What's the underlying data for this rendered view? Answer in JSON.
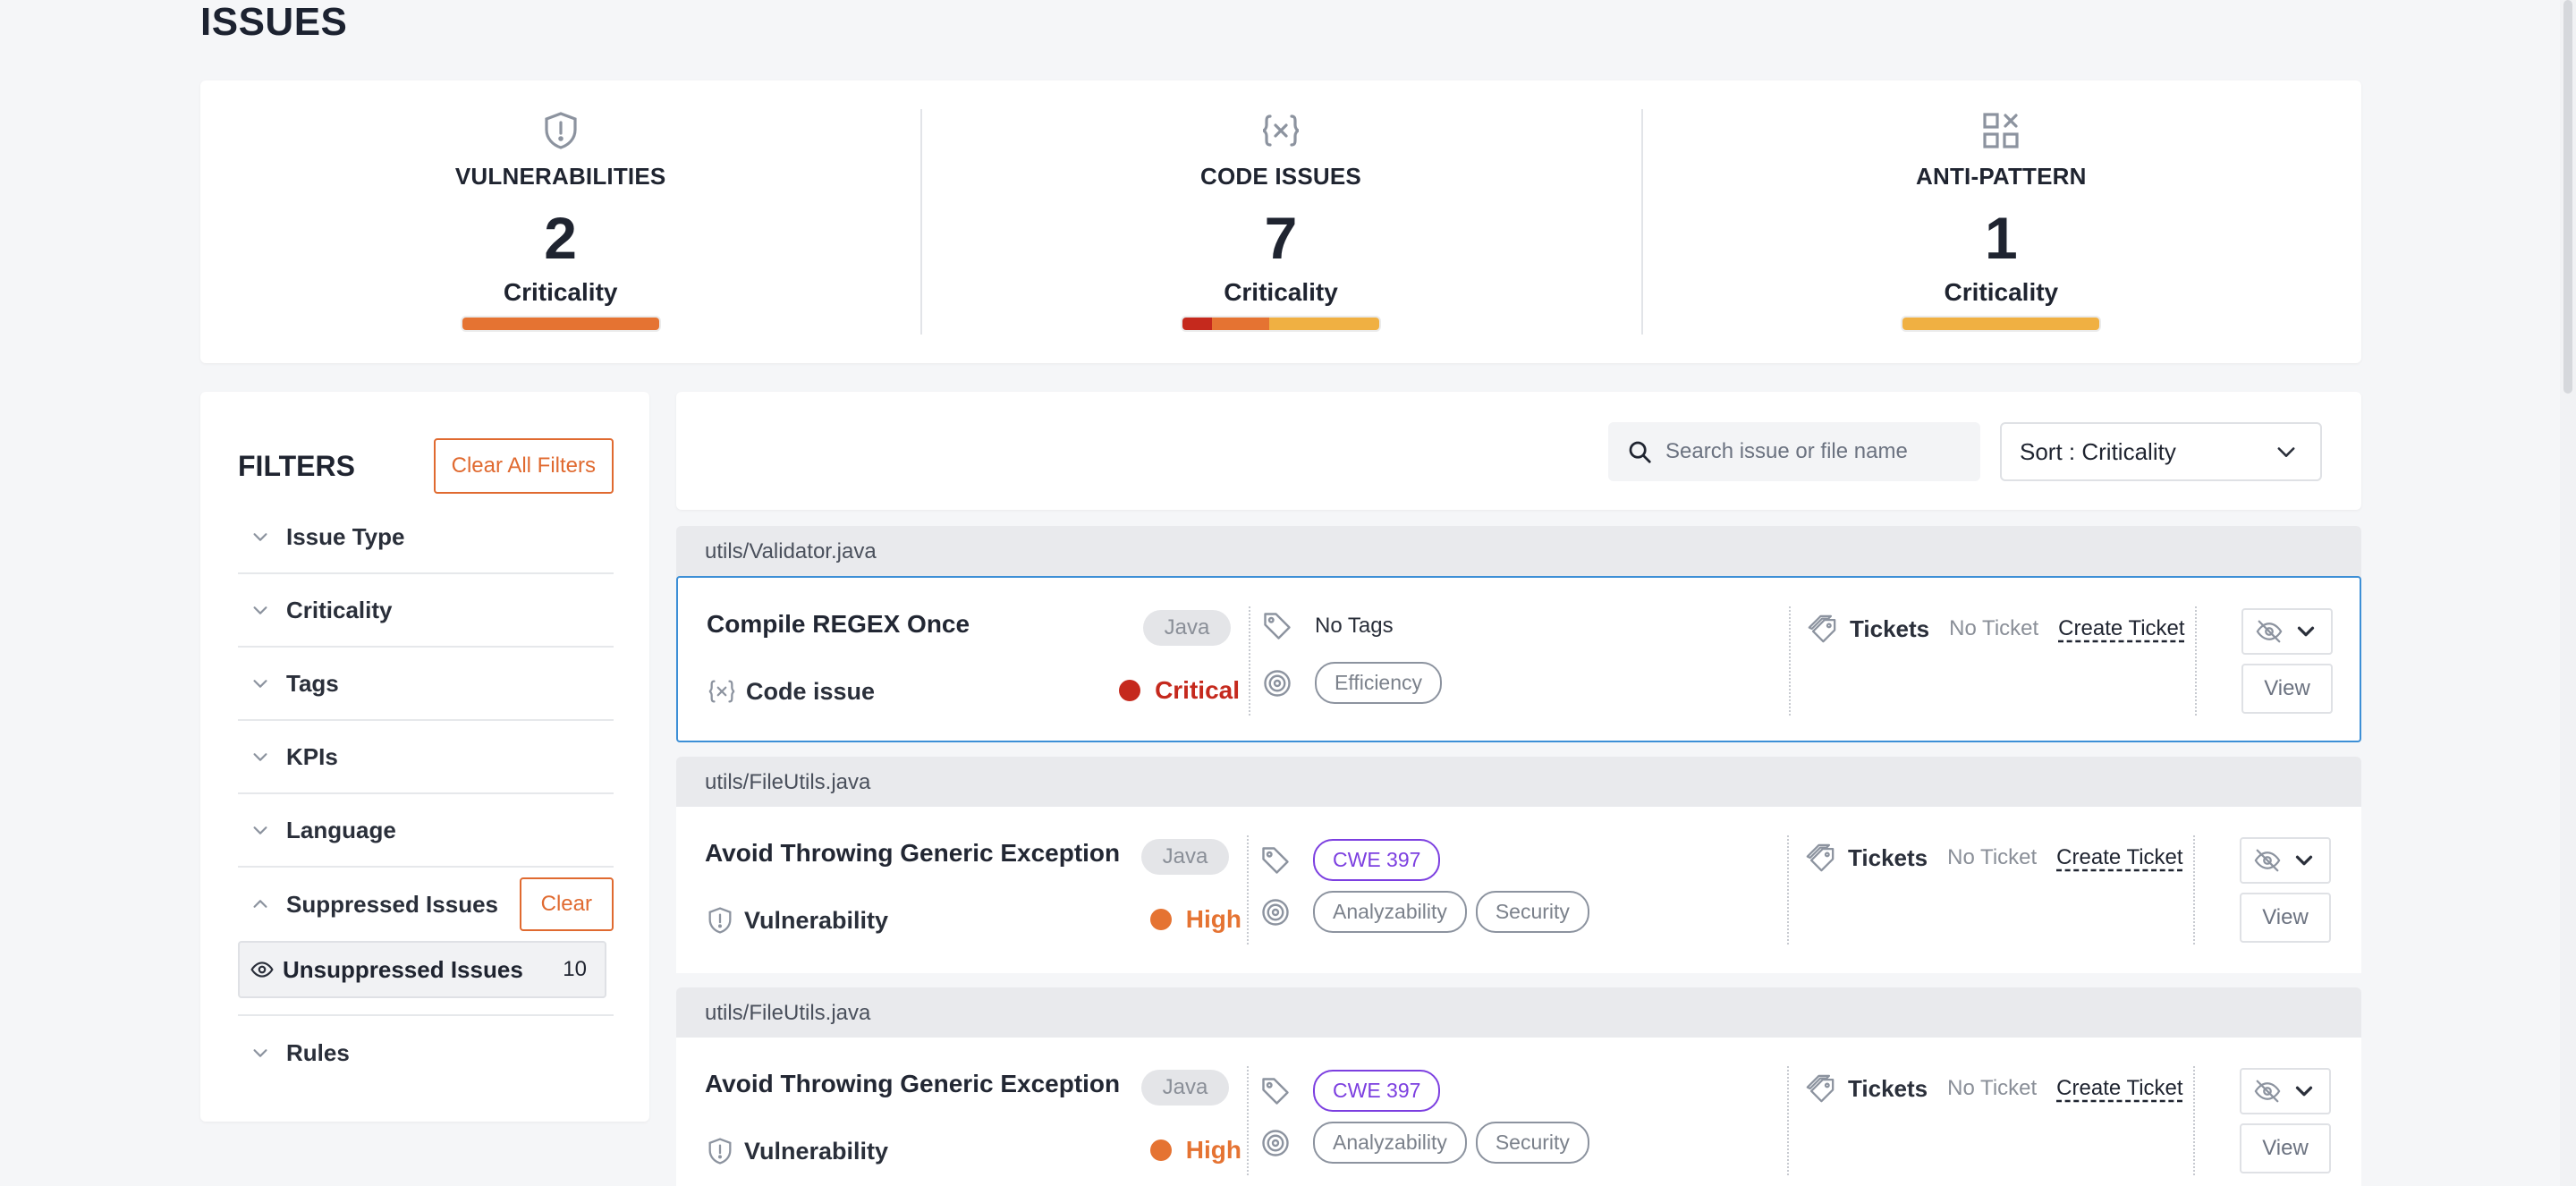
{
  "page": {
    "title": "ISSUES"
  },
  "summary": [
    {
      "title": "VULNERABILITIES",
      "count": "2",
      "criticality_label": "Criticality",
      "icon": "shield-alert-icon",
      "criticality_breakdown": [
        {
          "level": "High",
          "fraction": 1.0,
          "color": "#e57332"
        }
      ]
    },
    {
      "title": "CODE ISSUES",
      "count": "7",
      "criticality_label": "Criticality",
      "icon": "code-variable-icon",
      "criticality_breakdown": [
        {
          "level": "Critical",
          "fraction": 0.15,
          "color": "#c5291d"
        },
        {
          "level": "High",
          "fraction": 0.29,
          "color": "#e57332"
        },
        {
          "level": "Medium",
          "fraction": 0.56,
          "color": "#f0b042"
        }
      ]
    },
    {
      "title": "ANTI-PATTERN",
      "count": "1",
      "criticality_label": "Criticality",
      "icon": "grid-x-icon",
      "criticality_breakdown": [
        {
          "level": "Medium",
          "fraction": 1.0,
          "color": "#f0b042"
        }
      ]
    }
  ],
  "filters": {
    "title": "FILTERS",
    "clear_all_label": "Clear All Filters",
    "items": [
      {
        "label": "Issue Type"
      },
      {
        "label": "Criticality"
      },
      {
        "label": "Tags"
      },
      {
        "label": "KPIs"
      },
      {
        "label": "Language"
      }
    ],
    "suppressed": {
      "label": "Suppressed Issues",
      "clear_label": "Clear",
      "selected_option": {
        "label": "Unsuppressed Issues",
        "count": "10"
      }
    },
    "rules": {
      "label": "Rules"
    }
  },
  "toolbar": {
    "search_placeholder": "Search issue or file name",
    "sort_label": "Sort :",
    "sort_value": "Criticality"
  },
  "issues": [
    {
      "file": "utils/Validator.java",
      "title": "Compile REGEX Once",
      "language": "Java",
      "type": "Code issue",
      "type_icon": "code-variable-icon",
      "criticality": "Critical",
      "criticality_color": "#c5291d",
      "tags_text": "No Tags",
      "tags": [],
      "kpis": [
        "Efficiency"
      ],
      "tickets_label": "Tickets",
      "ticket_status": "No Ticket",
      "create_ticket_label": "Create Ticket",
      "view_label": "View",
      "selected": true
    },
    {
      "file": "utils/FileUtils.java",
      "title": "Avoid Throwing Generic Exception",
      "language": "Java",
      "type": "Vulnerability",
      "type_icon": "shield-alert-icon",
      "criticality": "High",
      "criticality_color": "#e57332",
      "tags_text": "",
      "tags": [
        "CWE 397"
      ],
      "kpis": [
        "Analyzability",
        "Security"
      ],
      "tickets_label": "Tickets",
      "ticket_status": "No Ticket",
      "create_ticket_label": "Create Ticket",
      "view_label": "View",
      "selected": false
    },
    {
      "file": "utils/FileUtils.java",
      "title": "Avoid Throwing Generic Exception",
      "language": "Java",
      "type": "Vulnerability",
      "type_icon": "shield-alert-icon",
      "criticality": "High",
      "criticality_color": "#e57332",
      "tags_text": "",
      "tags": [
        "CWE 397"
      ],
      "kpis": [
        "Analyzability",
        "Security"
      ],
      "tickets_label": "Tickets",
      "ticket_status": "No Ticket",
      "create_ticket_label": "Create Ticket",
      "view_label": "View",
      "selected": false
    }
  ]
}
